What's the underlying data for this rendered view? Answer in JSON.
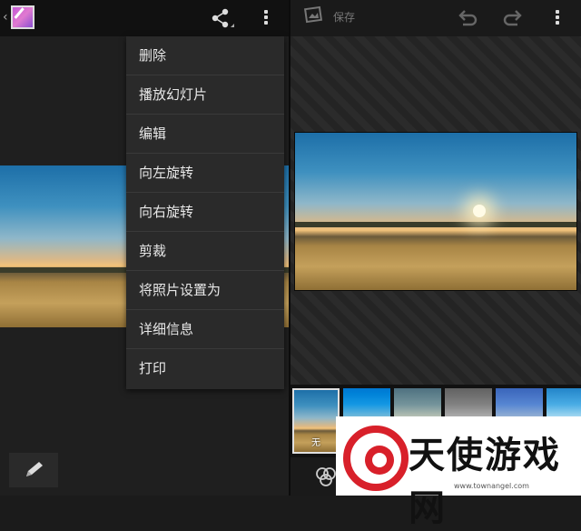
{
  "left_panel": {
    "menu_items": [
      "删除",
      "播放幻灯片",
      "编辑",
      "向左旋转",
      "向右旋转",
      "剪裁",
      "将照片设置为",
      "详细信息",
      "打印"
    ]
  },
  "right_panel": {
    "save_label": "保存",
    "filter_none_label": "无"
  },
  "watermark": {
    "text": "天使游戏网",
    "url": "www.townangel.com"
  },
  "colors": {
    "menu_bg": "#2a2a2a",
    "topbar_bg": "#111111",
    "watermark_red": "#d8202a"
  }
}
